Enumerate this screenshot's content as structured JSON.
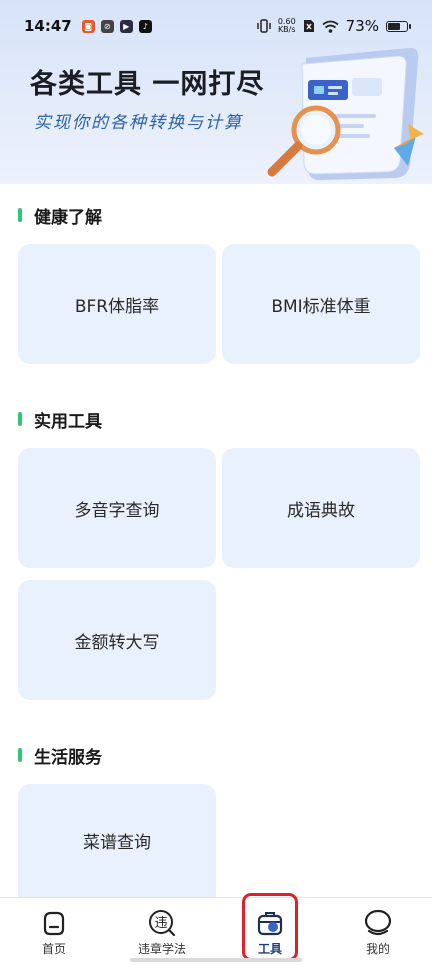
{
  "status_bar": {
    "time": "14:47",
    "net_speed_value": "0.60",
    "net_speed_unit": "KB/s",
    "battery": "73%",
    "battery_level": 0.73
  },
  "banner": {
    "title": "各类工具 一网打尽",
    "subtitle": "实现你的各种转换与计算"
  },
  "sections": [
    {
      "title": "健康了解",
      "items": [
        "BFR体脂率",
        "BMI标准体重"
      ]
    },
    {
      "title": "实用工具",
      "items": [
        "多音字查询",
        "成语典故",
        "金额转大写"
      ]
    },
    {
      "title": "生活服务",
      "items": [
        "菜谱查询"
      ]
    }
  ],
  "bottom_nav": [
    {
      "label": "首页",
      "icon": "home-icon"
    },
    {
      "label": "违章学法",
      "icon": "violation-icon"
    },
    {
      "label": "工具",
      "icon": "toolbox-icon",
      "active": true
    },
    {
      "label": "我的",
      "icon": "profile-icon"
    }
  ],
  "colors": {
    "accent": "#2ec774",
    "tile_bg": "#e9f1fd",
    "active_nav": "#1f3f7d",
    "highlight": "#e0202a"
  }
}
